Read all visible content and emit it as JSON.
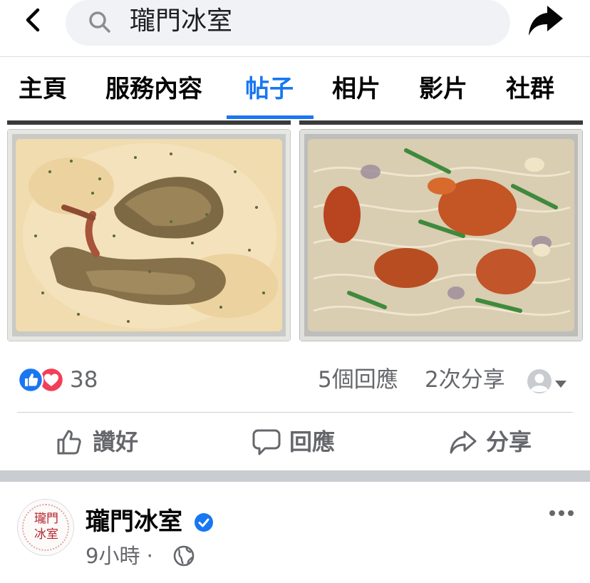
{
  "search": {
    "query": "瓏門冰室"
  },
  "tabs": [
    {
      "label": "主頁"
    },
    {
      "label": "服務內容"
    },
    {
      "label": "帖子"
    },
    {
      "label": "相片"
    },
    {
      "label": "影片"
    },
    {
      "label": "社群"
    }
  ],
  "active_tab": "帖子",
  "reactions": {
    "count": "38",
    "types": [
      "like",
      "love"
    ]
  },
  "engagement": {
    "comments": "5個回應",
    "shares": "2次分享"
  },
  "actions": {
    "like": "讚好",
    "comment": "回應",
    "share": "分享"
  },
  "next_post": {
    "page_name": "瓏門冰室",
    "verified": true,
    "time": "9小時 ·",
    "avatar_logo_line1": "瓏門",
    "avatar_logo_line2": "冰室"
  },
  "colors": {
    "accent": "#1877f2",
    "secondary_text": "#65676b",
    "like": "#1877f2",
    "love": "#f33e58"
  },
  "icons": [
    "back-arrow-icon",
    "search-icon",
    "share-arrow-icon",
    "like-reaction-icon",
    "love-reaction-icon",
    "thumbs-up-icon",
    "comment-bubble-icon",
    "share-icon",
    "verified-badge-icon",
    "globe-icon",
    "more-dots-icon"
  ]
}
